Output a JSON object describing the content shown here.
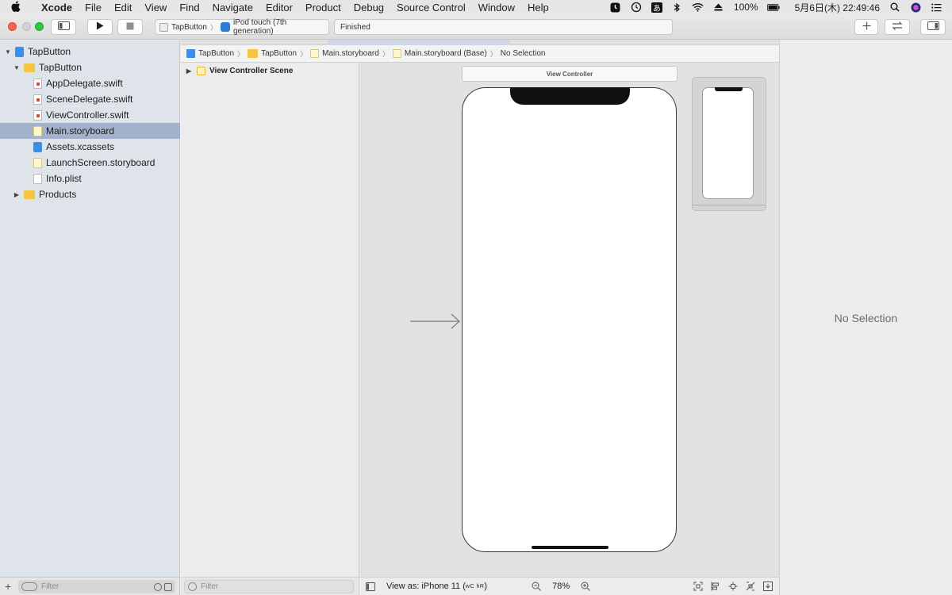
{
  "menubar": {
    "app_name": "Xcode",
    "items": [
      "File",
      "Edit",
      "View",
      "Find",
      "Navigate",
      "Editor",
      "Product",
      "Debug",
      "Source Control",
      "Window",
      "Help"
    ],
    "ime_label": "あ",
    "battery": "100%",
    "clock": "5月6日(木)  22:49:46"
  },
  "toolbar": {
    "scheme_name": "TapButton",
    "destination": "iPod touch (7th generation)",
    "activity_status": "Finished"
  },
  "navigator": {
    "items": [
      {
        "label": "TapButton",
        "icon": "project-icon"
      },
      {
        "label": "TapButton",
        "icon": "folder-icon"
      },
      {
        "label": "AppDelegate.swift",
        "icon": "swift-file-icon"
      },
      {
        "label": "SceneDelegate.swift",
        "icon": "swift-file-icon"
      },
      {
        "label": "ViewController.swift",
        "icon": "swift-file-icon"
      },
      {
        "label": "Main.storyboard",
        "icon": "storyboard-icon",
        "selected": true
      },
      {
        "label": "Assets.xcassets",
        "icon": "assets-icon"
      },
      {
        "label": "LaunchScreen.storyboard",
        "icon": "storyboard-icon"
      },
      {
        "label": "Info.plist",
        "icon": "plist-icon"
      },
      {
        "label": "Products",
        "icon": "folder-icon"
      }
    ],
    "filter_placeholder": "Filter"
  },
  "jumpbar": {
    "crumbs": [
      "TapButton",
      "TapButton",
      "Main.storyboard",
      "Main.storyboard (Base)",
      "No Selection"
    ]
  },
  "outline": {
    "scene_label": "View Controller Scene",
    "filter_placeholder": "Filter"
  },
  "canvas": {
    "scene_title": "View Controller",
    "view_as_label": "View as: iPhone 11 (",
    "view_as_size": "wC hR",
    "view_as_close": ")",
    "zoom": "78%"
  },
  "inspector": {
    "empty_label": "No Selection"
  },
  "colors": {
    "selection": "#a3b1cc",
    "navigator_bg": "#dfe4ea",
    "canvas_bg": "#e2e2e4"
  }
}
